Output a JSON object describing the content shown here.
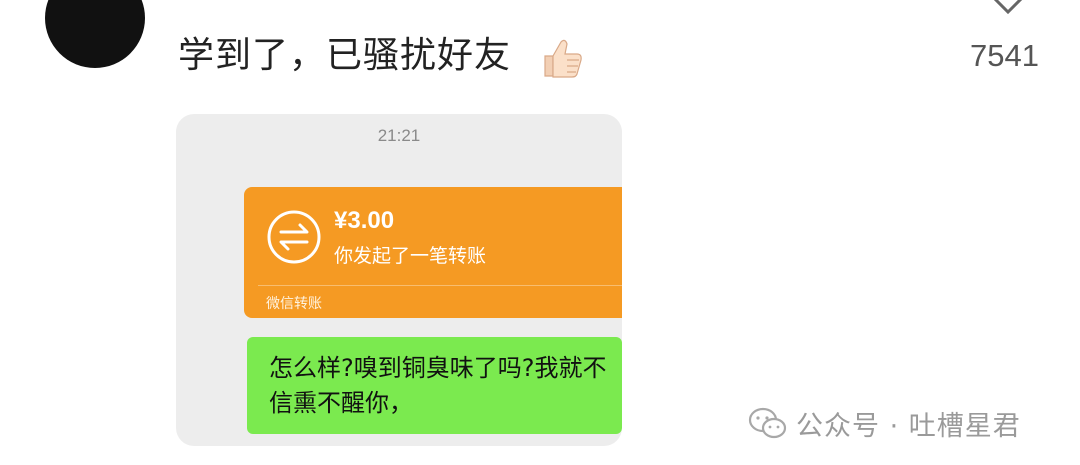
{
  "comment": {
    "text": "学到了，已骚扰好友",
    "emoji": "thumbs-up-icon",
    "like_count": "7541"
  },
  "chat_screenshot": {
    "time": "21:21",
    "transfer": {
      "amount": "¥3.00",
      "description": "你发起了一笔转账",
      "footer": "微信转账",
      "color": "#f59a23"
    },
    "message": {
      "text": "怎么样?嗅到铜臭味了吗?我就不信熏不醒你，",
      "color": "#7bea4f"
    }
  },
  "watermark": {
    "text": "公众号 · 吐槽星君",
    "icon": "wechat-icon"
  }
}
